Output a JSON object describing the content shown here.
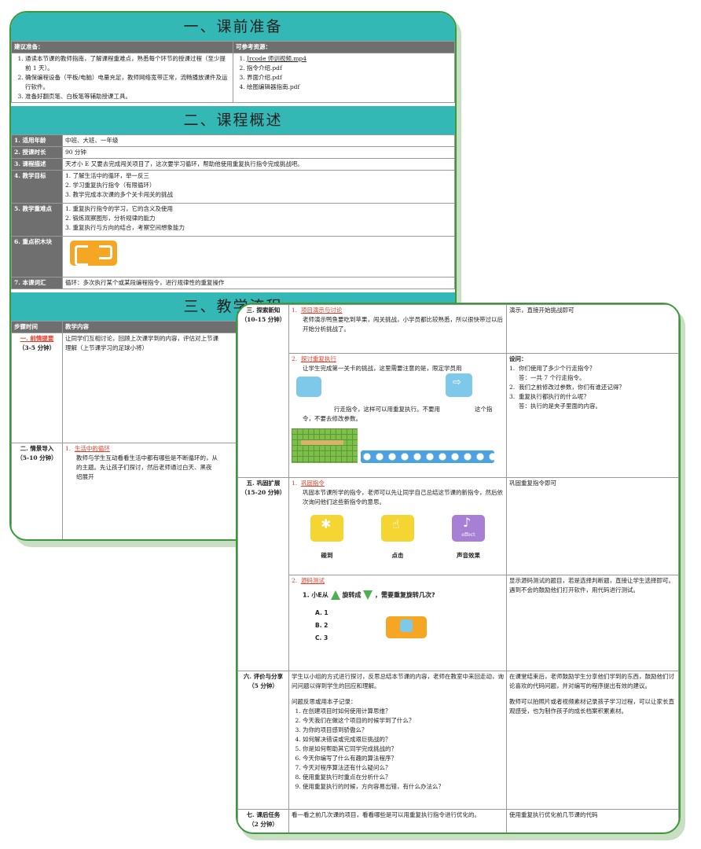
{
  "back": {
    "prep": {
      "title": "一、课前准备",
      "left_header": "建议准备：",
      "right_header": "可参考资源：",
      "left_items": [
        "通读本节课的教师指南，了解课程重难点，熟悉每个环节的授课过程（至少提前 1 天）。",
        "确保编程设备（平板/电脑）电量充足，教师网络宽带正常，流畅播放课件及运行软件。",
        "准备好翻页笔、白板笔等辅助授课工具。"
      ],
      "right_items": [
        "Jrcode 师训视频.mp4",
        "指令介绍.pdf",
        "界面介绍.pdf",
        "绘图编辑器指南.pdf"
      ]
    },
    "overview": {
      "title": "二、课程概述",
      "rows": [
        {
          "label": "1. 适用年龄",
          "lines": [
            "中班、大班、一年级"
          ]
        },
        {
          "label": "2. 授课时长",
          "lines": [
            "90 分钟"
          ]
        },
        {
          "label": "3. 课程描述",
          "lines": [
            "天才小 E 又要去完成闯关项目了，这次要学习循环，帮助他使用重复执行指令完成挑战吧。"
          ]
        },
        {
          "label": "4. 教学目标",
          "lines": [
            "1. 了解生活中的循环，举一反三",
            "2. 学习重复执行指令（有限循环）",
            "3. 教学完成本次课的多个关卡闯关的挑战"
          ]
        },
        {
          "label": "5. 教学重难点",
          "lines": [
            "1. 重复执行指令的学习，它的含义及使用",
            "2. 锻炼观察图形，分析规律的能力",
            "3. 重复执行与方向的结合，考察空间想象能力"
          ]
        },
        {
          "label": "6. 重点积木块",
          "lines": []
        },
        {
          "label": "7. 本课词汇",
          "lines": [
            "循环：多次执行某个或某段编程指令，进行规律性的重复操作"
          ]
        }
      ]
    },
    "flow": {
      "title": "三、教学流程",
      "h_step": "步骤时间",
      "h_content": "教学内容",
      "r1_step": "一. 前情提要",
      "r1_time": "（3-5 分钟）",
      "r1_text": "让同学们互相讨论，回顾上次课学到的内容，评估对上节课",
      "r1_text2": "理解（上节课学习的足球小将）",
      "r2_step": "二. 情景导入",
      "r2_time": "（5-10 分钟）",
      "r2_item_title": "生活中的循环",
      "r2_text": "教师与学生互动看看生活中都有哪些是不断循环的，从",
      "r2_text2": "的主题。先让孩子们探讨，然后老师通过白天、黑夜",
      "r2_text3": "绍展开"
    }
  },
  "front": {
    "rows": [
      {
        "step": "三. 探索新知",
        "time": "（10-15 分钟）",
        "blocks": [
          {
            "title": "项目演示与讨论",
            "text": "老师演示鸭鱼要吃到苹果，闯关挑战，小学员都比较熟悉，所以很快带过以后开始分析挑战了。",
            "note": "演示，直接开始挑战即可"
          },
          {
            "title": "探讨重复执行",
            "text": "让学生完成第一关卡的挑战，这里需要注意的是，限定学员用",
            "text2": "行走指令，这样可以用重复执行。不要用",
            "text3": "这个指令，不要去修改参数。",
            "note_title": "设问：",
            "note_items": [
              "你们使用了多少个行走指令？",
              "答：一共 7 个行走指令。",
              "我们之前修改过参数，你们有谁还记得？",
              "重复执行都执行的什么呢？",
              "答：执行的是夹子里面的内容。"
            ],
            "repeat_num": "1"
          }
        ]
      },
      {
        "step": "五. 巩固扩展",
        "time": "（15-20 分钟）",
        "blocks": [
          {
            "title": "巩固指令",
            "text": "巩固本节课所学的指令，老师可以先让同学自己总结这节课的新指令，然后依次询问他们这些新指令的意思。",
            "note": "巩固重复指令即可",
            "icons": [
              {
                "label": "碰到",
                "icon": "runner-icon"
              },
              {
                "label": "点击",
                "icon": "tap-icon"
              },
              {
                "label": "声音效果",
                "icon": "music-icon",
                "sub": "effect"
              }
            ]
          },
          {
            "title": "源码测试",
            "note": "显示源码测试的题目，若是选择判断题，直接让学生选择即可。遇到不会的鼓励他们打开软件，用代码进行测试。",
            "quiz_q": "1. 小E从",
            "quiz_q2": "旋转成",
            "quiz_q3": "，需要重复旋转几次?",
            "options": [
              "A. 1",
              "B. 2",
              "C. 3"
            ],
            "repeat_num": "1"
          }
        ]
      },
      {
        "step": "六. 评价与分享",
        "time": "（5 分钟）",
        "text": "学生以小组的方式进行探讨，反思总结本节课的内容，老师在教室中来回走动，询问问题以得到学生的回应和理解。",
        "q_intro": "问题反思或用本子记录：",
        "questions": [
          "在创建项目时如何使用计算思维？",
          "今天我们在做这个项目的时候学到了什么？",
          "为你的项目感到骄傲么？",
          "如何解决错误或完成艰巨挑战的？",
          "你是如何帮助其它同学完成挑战的？",
          "今天你编写了什么有趣的算法程序？",
          "今天对程序算法还有什么疑问么？",
          "使用重复执行时重点在分析什么？",
          "使用重复执行的时候，方向容易出错，有什么办法么？"
        ],
        "note": "在课堂结束后，老师鼓励学生分享他们学到的东西，鼓励他们讨论喜欢的代码问题，并对编写的程序提出有效的建议。",
        "note2": "教师可以拍照片或者视频素材记录孩子学习过程，可以让家长直观感受，也为制作孩子的成长档案积累素材。"
      },
      {
        "step": "七. 课后任务",
        "time": "（2 分钟）",
        "text": "看一看之前几次课的项目，看看哪些是可以用重复执行指令进行优化的。",
        "note": "使用重复执行优化前几节课的代码"
      }
    ]
  },
  "colors": {
    "teal": "#33b8b6",
    "border": "#3a9a3a",
    "label_bg": "#6f6f6f",
    "red": "#e0402c"
  }
}
